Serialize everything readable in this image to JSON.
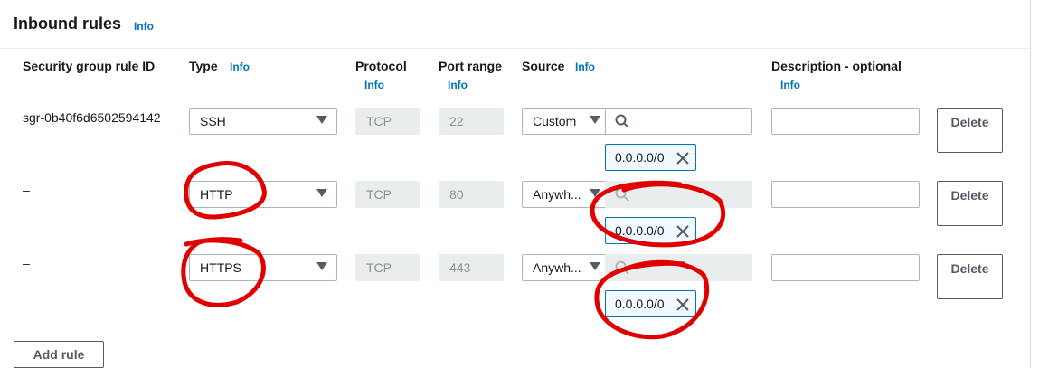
{
  "section": {
    "title": "Inbound rules",
    "info": "Info"
  },
  "columns": {
    "rule_id": "Security group rule ID",
    "type": "Type",
    "protocol": "Protocol",
    "port_range": "Port range",
    "source": "Source",
    "description": "Description - optional",
    "info": "Info"
  },
  "rows": [
    {
      "rule_id": "sgr-0b40f6d6502594142",
      "type": "SSH",
      "protocol": "TCP",
      "port": "22",
      "source": "Custom",
      "cidr": "0.0.0.0/0",
      "delete": "Delete"
    },
    {
      "rule_id": "–",
      "type": "HTTP",
      "protocol": "TCP",
      "port": "80",
      "source": "Anywh...",
      "cidr": "0.0.0.0/0",
      "delete": "Delete"
    },
    {
      "rule_id": "–",
      "type": "HTTPS",
      "protocol": "TCP",
      "port": "443",
      "source": "Anywh...",
      "cidr": "0.0.0.0/0",
      "delete": "Delete"
    }
  ],
  "add_rule": "Add rule",
  "colors": {
    "link": "#0073bb",
    "annotation": "#e00000",
    "border": "#aab7b8",
    "disabled_bg": "#eaeded"
  }
}
